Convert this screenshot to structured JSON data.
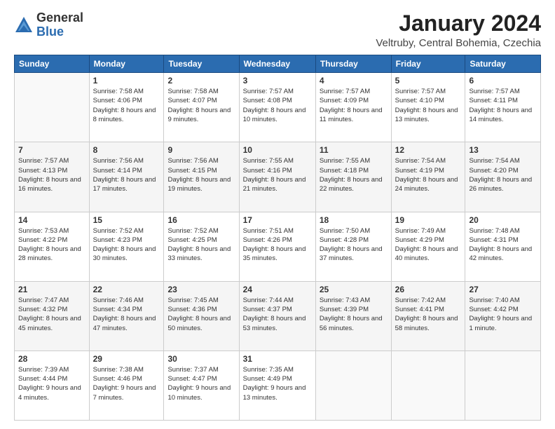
{
  "logo": {
    "general": "General",
    "blue": "Blue"
  },
  "header": {
    "month": "January 2024",
    "location": "Veltruby, Central Bohemia, Czechia"
  },
  "weekdays": [
    "Sunday",
    "Monday",
    "Tuesday",
    "Wednesday",
    "Thursday",
    "Friday",
    "Saturday"
  ],
  "weeks": [
    [
      {
        "day": "",
        "sunrise": "",
        "sunset": "",
        "daylight": ""
      },
      {
        "day": "1",
        "sunrise": "Sunrise: 7:58 AM",
        "sunset": "Sunset: 4:06 PM",
        "daylight": "Daylight: 8 hours and 8 minutes."
      },
      {
        "day": "2",
        "sunrise": "Sunrise: 7:58 AM",
        "sunset": "Sunset: 4:07 PM",
        "daylight": "Daylight: 8 hours and 9 minutes."
      },
      {
        "day": "3",
        "sunrise": "Sunrise: 7:57 AM",
        "sunset": "Sunset: 4:08 PM",
        "daylight": "Daylight: 8 hours and 10 minutes."
      },
      {
        "day": "4",
        "sunrise": "Sunrise: 7:57 AM",
        "sunset": "Sunset: 4:09 PM",
        "daylight": "Daylight: 8 hours and 11 minutes."
      },
      {
        "day": "5",
        "sunrise": "Sunrise: 7:57 AM",
        "sunset": "Sunset: 4:10 PM",
        "daylight": "Daylight: 8 hours and 13 minutes."
      },
      {
        "day": "6",
        "sunrise": "Sunrise: 7:57 AM",
        "sunset": "Sunset: 4:11 PM",
        "daylight": "Daylight: 8 hours and 14 minutes."
      }
    ],
    [
      {
        "day": "7",
        "sunrise": "Sunrise: 7:57 AM",
        "sunset": "Sunset: 4:13 PM",
        "daylight": "Daylight: 8 hours and 16 minutes."
      },
      {
        "day": "8",
        "sunrise": "Sunrise: 7:56 AM",
        "sunset": "Sunset: 4:14 PM",
        "daylight": "Daylight: 8 hours and 17 minutes."
      },
      {
        "day": "9",
        "sunrise": "Sunrise: 7:56 AM",
        "sunset": "Sunset: 4:15 PM",
        "daylight": "Daylight: 8 hours and 19 minutes."
      },
      {
        "day": "10",
        "sunrise": "Sunrise: 7:55 AM",
        "sunset": "Sunset: 4:16 PM",
        "daylight": "Daylight: 8 hours and 21 minutes."
      },
      {
        "day": "11",
        "sunrise": "Sunrise: 7:55 AM",
        "sunset": "Sunset: 4:18 PM",
        "daylight": "Daylight: 8 hours and 22 minutes."
      },
      {
        "day": "12",
        "sunrise": "Sunrise: 7:54 AM",
        "sunset": "Sunset: 4:19 PM",
        "daylight": "Daylight: 8 hours and 24 minutes."
      },
      {
        "day": "13",
        "sunrise": "Sunrise: 7:54 AM",
        "sunset": "Sunset: 4:20 PM",
        "daylight": "Daylight: 8 hours and 26 minutes."
      }
    ],
    [
      {
        "day": "14",
        "sunrise": "Sunrise: 7:53 AM",
        "sunset": "Sunset: 4:22 PM",
        "daylight": "Daylight: 8 hours and 28 minutes."
      },
      {
        "day": "15",
        "sunrise": "Sunrise: 7:52 AM",
        "sunset": "Sunset: 4:23 PM",
        "daylight": "Daylight: 8 hours and 30 minutes."
      },
      {
        "day": "16",
        "sunrise": "Sunrise: 7:52 AM",
        "sunset": "Sunset: 4:25 PM",
        "daylight": "Daylight: 8 hours and 33 minutes."
      },
      {
        "day": "17",
        "sunrise": "Sunrise: 7:51 AM",
        "sunset": "Sunset: 4:26 PM",
        "daylight": "Daylight: 8 hours and 35 minutes."
      },
      {
        "day": "18",
        "sunrise": "Sunrise: 7:50 AM",
        "sunset": "Sunset: 4:28 PM",
        "daylight": "Daylight: 8 hours and 37 minutes."
      },
      {
        "day": "19",
        "sunrise": "Sunrise: 7:49 AM",
        "sunset": "Sunset: 4:29 PM",
        "daylight": "Daylight: 8 hours and 40 minutes."
      },
      {
        "day": "20",
        "sunrise": "Sunrise: 7:48 AM",
        "sunset": "Sunset: 4:31 PM",
        "daylight": "Daylight: 8 hours and 42 minutes."
      }
    ],
    [
      {
        "day": "21",
        "sunrise": "Sunrise: 7:47 AM",
        "sunset": "Sunset: 4:32 PM",
        "daylight": "Daylight: 8 hours and 45 minutes."
      },
      {
        "day": "22",
        "sunrise": "Sunrise: 7:46 AM",
        "sunset": "Sunset: 4:34 PM",
        "daylight": "Daylight: 8 hours and 47 minutes."
      },
      {
        "day": "23",
        "sunrise": "Sunrise: 7:45 AM",
        "sunset": "Sunset: 4:36 PM",
        "daylight": "Daylight: 8 hours and 50 minutes."
      },
      {
        "day": "24",
        "sunrise": "Sunrise: 7:44 AM",
        "sunset": "Sunset: 4:37 PM",
        "daylight": "Daylight: 8 hours and 53 minutes."
      },
      {
        "day": "25",
        "sunrise": "Sunrise: 7:43 AM",
        "sunset": "Sunset: 4:39 PM",
        "daylight": "Daylight: 8 hours and 56 minutes."
      },
      {
        "day": "26",
        "sunrise": "Sunrise: 7:42 AM",
        "sunset": "Sunset: 4:41 PM",
        "daylight": "Daylight: 8 hours and 58 minutes."
      },
      {
        "day": "27",
        "sunrise": "Sunrise: 7:40 AM",
        "sunset": "Sunset: 4:42 PM",
        "daylight": "Daylight: 9 hours and 1 minute."
      }
    ],
    [
      {
        "day": "28",
        "sunrise": "Sunrise: 7:39 AM",
        "sunset": "Sunset: 4:44 PM",
        "daylight": "Daylight: 9 hours and 4 minutes."
      },
      {
        "day": "29",
        "sunrise": "Sunrise: 7:38 AM",
        "sunset": "Sunset: 4:46 PM",
        "daylight": "Daylight: 9 hours and 7 minutes."
      },
      {
        "day": "30",
        "sunrise": "Sunrise: 7:37 AM",
        "sunset": "Sunset: 4:47 PM",
        "daylight": "Daylight: 9 hours and 10 minutes."
      },
      {
        "day": "31",
        "sunrise": "Sunrise: 7:35 AM",
        "sunset": "Sunset: 4:49 PM",
        "daylight": "Daylight: 9 hours and 13 minutes."
      },
      {
        "day": "",
        "sunrise": "",
        "sunset": "",
        "daylight": ""
      },
      {
        "day": "",
        "sunrise": "",
        "sunset": "",
        "daylight": ""
      },
      {
        "day": "",
        "sunrise": "",
        "sunset": "",
        "daylight": ""
      }
    ]
  ]
}
